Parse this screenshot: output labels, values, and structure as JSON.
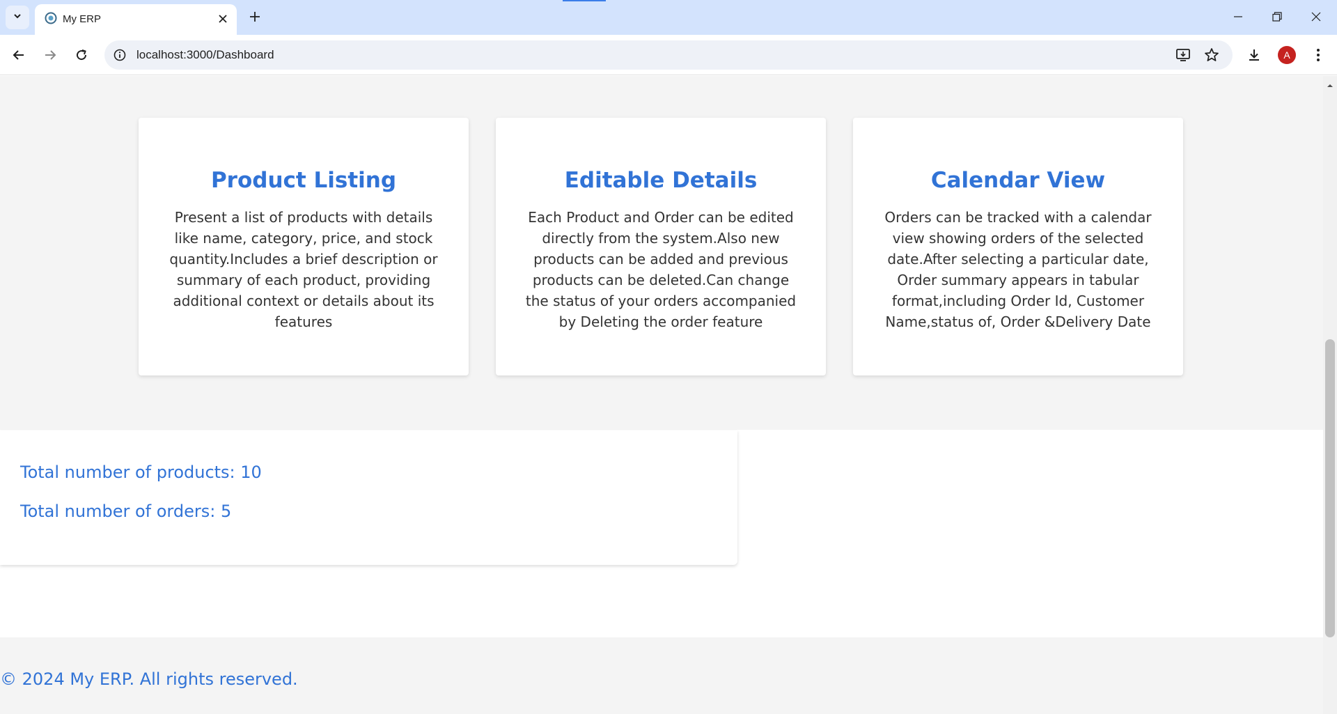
{
  "browser": {
    "tab_title": "My ERP",
    "url": "localhost:3000/Dashboard",
    "avatar_letter": "A"
  },
  "features": [
    {
      "title": "Product Listing",
      "description": "Present a list of products with details like name, category, price, and stock quantity.Includes a brief description or summary of each product, providing additional context or details about its features"
    },
    {
      "title": "Editable Details",
      "description": "Each Product and Order can be edited directly from the system.Also new products can be added and previous products can be deleted.Can change the status of your orders accompanied by Deleting the order feature"
    },
    {
      "title": "Calendar View",
      "description": "Orders can be tracked with a calendar view showing orders of the selected date.After selecting a particular date, Order summary appears in tabular format,including Order Id, Customer Name,status of, Order &Delivery Date"
    }
  ],
  "stats": {
    "products": "Total number of products: 10",
    "orders": "Total number of orders: 5"
  },
  "footer": {
    "text": "© 2024 My ERP. All rights reserved."
  },
  "colors": {
    "accent": "#3173d6",
    "tabbar": "#d3e3fd",
    "section_bg": "#f4f4f4"
  }
}
